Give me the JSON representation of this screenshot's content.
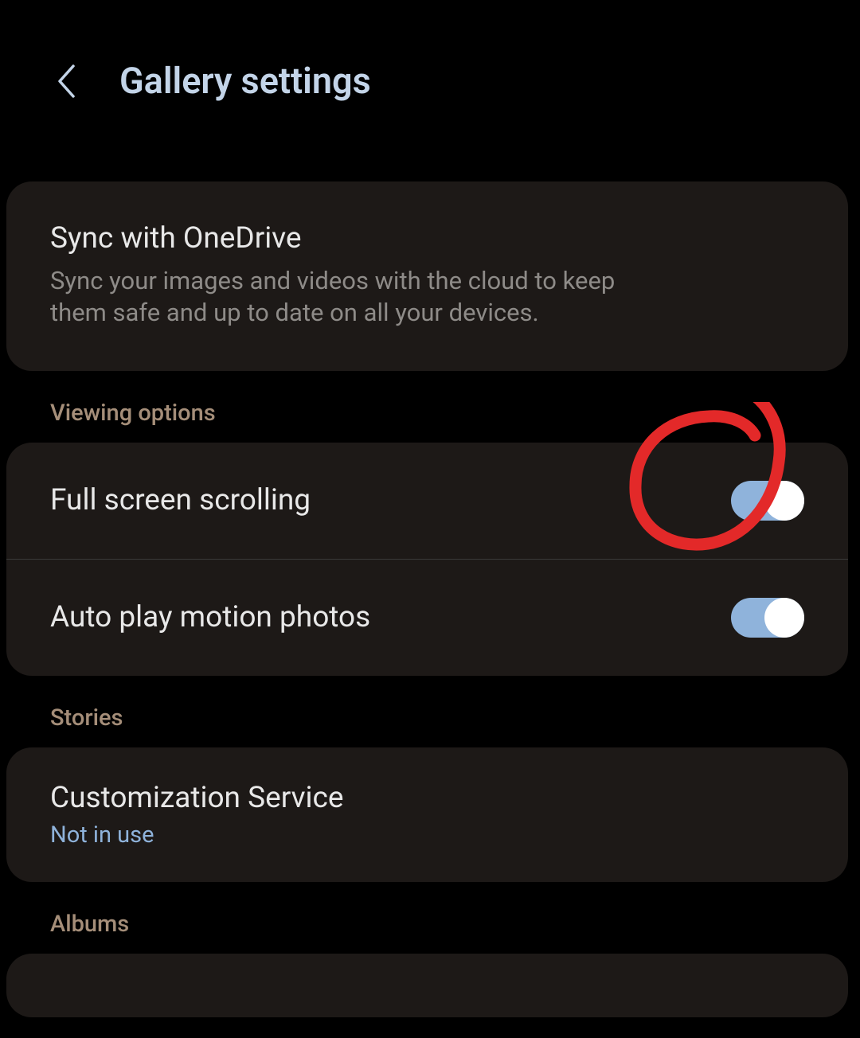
{
  "header": {
    "title": "Gallery settings"
  },
  "sync": {
    "title": "Sync with OneDrive",
    "description": "Sync your images and videos with the cloud to keep them safe and up to date on all your devices."
  },
  "sections": {
    "viewing": {
      "header": "Viewing options",
      "fullScreen": {
        "label": "Full screen scrolling",
        "on": true
      },
      "autoPlay": {
        "label": "Auto play motion photos",
        "on": true
      }
    },
    "stories": {
      "header": "Stories",
      "customization": {
        "label": "Customization Service",
        "status": "Not in use"
      }
    },
    "albums": {
      "header": "Albums"
    }
  }
}
